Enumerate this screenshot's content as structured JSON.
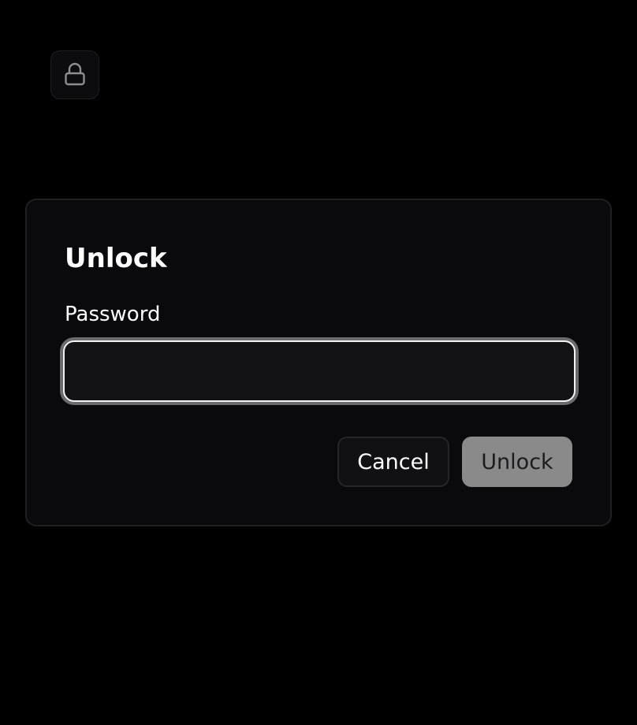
{
  "lock_button": {
    "icon": "lock-icon"
  },
  "dialog": {
    "title": "Unlock",
    "password": {
      "label": "Password",
      "value": "",
      "placeholder": ""
    },
    "actions": {
      "cancel_label": "Cancel",
      "unlock_label": "Unlock"
    }
  },
  "colors": {
    "background": "#000000",
    "dialog_background": "#0a0a0c",
    "input_focus_ring": "#6b6b6e",
    "unlock_button_disabled": "#8a8a8a"
  }
}
